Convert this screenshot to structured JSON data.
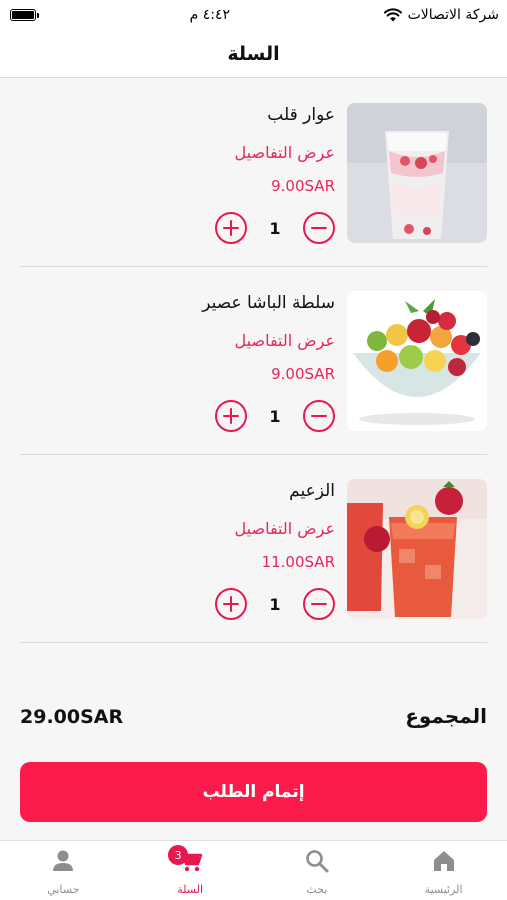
{
  "status_bar": {
    "carrier": "شركة الاتصالات",
    "time": "٤:٤٢ م"
  },
  "header": {
    "title": "السلة"
  },
  "cart_items": [
    {
      "name": "عوار قلب",
      "details_label": "عرض التفاصيل",
      "price": "9.00SAR",
      "quantity": "1"
    },
    {
      "name": "سلطة الباشا عصير",
      "details_label": "عرض التفاصيل",
      "price": "9.00SAR",
      "quantity": "1"
    },
    {
      "name": "الزعيم",
      "details_label": "عرض التفاصيل",
      "price": "11.00SAR",
      "quantity": "1"
    }
  ],
  "summary": {
    "total_label": "المجموع",
    "total_value": "29.00SAR"
  },
  "checkout": {
    "label": "إتمام الطلب"
  },
  "tab_bar": {
    "tabs": [
      {
        "label": "حسابي",
        "icon": "person-icon"
      },
      {
        "label": "السلة",
        "icon": "cart-icon",
        "badge": "3",
        "active": true
      },
      {
        "label": "بحث",
        "icon": "search-icon"
      },
      {
        "label": "الرئيسية",
        "icon": "home-icon"
      }
    ]
  },
  "colors": {
    "accent": "#e8184f",
    "button": "#fb1b4b",
    "background": "#f6f6f6"
  }
}
